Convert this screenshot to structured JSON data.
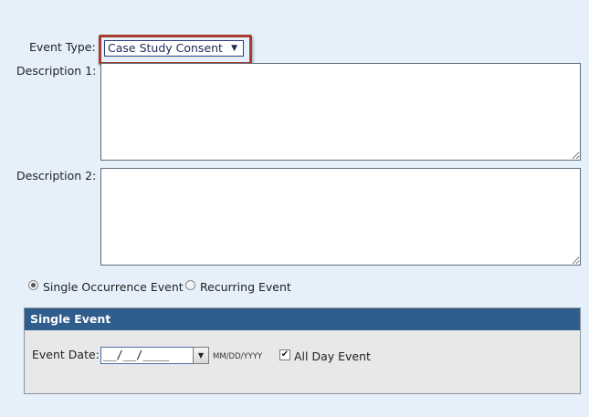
{
  "event_type": {
    "label": "Event Type:",
    "selected": "Case Study Consent",
    "arrow": "▼"
  },
  "description1": {
    "label": "Description 1:",
    "value": ""
  },
  "description2": {
    "label": "Description 2:",
    "value": ""
  },
  "occurrence": {
    "single_label": "Single Occurrence Event",
    "recurring_label": "Recurring Event",
    "selected": "single"
  },
  "single_event": {
    "header": "Single Event",
    "date_label": "Event Date:",
    "date_value": "__/__/____",
    "date_format": "MM/DD/YYYY",
    "date_button_icon": "▼",
    "all_day_label": "All Day Event",
    "all_day_checked": true,
    "check_mark": "✔"
  },
  "colors": {
    "page_bg": "#e5f0fb",
    "highlight_border": "#a93b2c",
    "panel_header": "#2f5d8c"
  }
}
